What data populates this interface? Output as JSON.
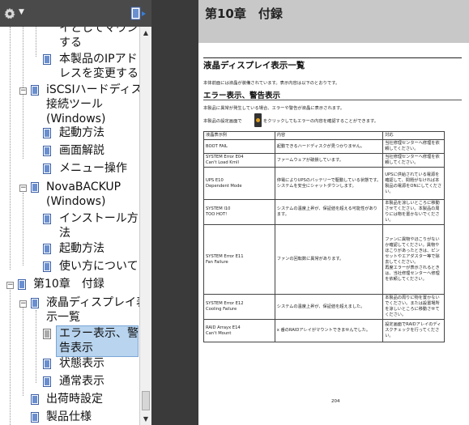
{
  "sidebar": {
    "toolbar": {
      "options_icon": "gear-icon",
      "bookmark_options_icon": "bookmark-options-icon"
    },
    "items": [
      {
        "label_lines": [
          "イとしてマウント",
          "する"
        ],
        "icon": "bookmark-icon"
      },
      {
        "label_lines": [
          "本製品のIPアド",
          "レスを変更する"
        ],
        "icon": "bookmark-icon"
      },
      {
        "label_lines": [
          "iSCSIハードディスク",
          "接続ツール",
          "(Windows)"
        ],
        "icon": "bookmark-icon",
        "expanded": true
      },
      {
        "label_lines": [
          "起動方法"
        ],
        "icon": "bookmark-icon"
      },
      {
        "label_lines": [
          "画面解説"
        ],
        "icon": "bookmark-icon"
      },
      {
        "label_lines": [
          "メニュー操作"
        ],
        "icon": "bookmark-icon"
      },
      {
        "label_lines": [
          "NovaBACKUP",
          "(Windows)"
        ],
        "icon": "bookmark-icon",
        "expanded": true
      },
      {
        "label_lines": [
          "インストール方",
          "法"
        ],
        "icon": "bookmark-icon"
      },
      {
        "label_lines": [
          "起動方法"
        ],
        "icon": "bookmark-icon"
      },
      {
        "label_lines": [
          "使い方について"
        ],
        "icon": "bookmark-icon"
      },
      {
        "label_lines": [
          "第10章　付録"
        ],
        "icon": "bookmark-icon",
        "expanded": true
      },
      {
        "label_lines": [
          "液晶ディスプレイ表",
          "示一覧"
        ],
        "icon": "bookmark-icon",
        "expanded": true
      },
      {
        "label_lines": [
          "エラー表示、警",
          "告表示"
        ],
        "icon": "bookmark-icon",
        "selected": true
      },
      {
        "label_lines": [
          "状態表示"
        ],
        "icon": "bookmark-icon"
      },
      {
        "label_lines": [
          "通常表示"
        ],
        "icon": "bookmark-icon"
      },
      {
        "label_lines": [
          "出荷時設定"
        ],
        "icon": "bookmark-icon"
      },
      {
        "label_lines": [
          "製品仕様"
        ],
        "icon": "bookmark-icon"
      }
    ]
  },
  "page": {
    "chapter_title": "第10章　付録",
    "section_title": "液晶ディスプレイ表示一覧",
    "intro": "本体前面には液晶が装備されています。表示内容は以下のとおりです。",
    "subsection_title": "エラー表示、警告表示",
    "desc1": "本製品に異常が発生している場合、エラーや警告が液晶に表示されます。",
    "desc2a": "本製品の設定画面で",
    "desc2b": "をクリックしてもエラーの内容を確認することができます。",
    "table": {
      "headers": [
        "液晶表示例",
        "内容",
        "対応"
      ],
      "rows": [
        [
          "BOOT FAIL",
          "起動できるハードディスクが見つかりません。",
          "当社修理センターへ修理を依頼してください。"
        ],
        [
          "SYSTEM Error E04\nCan't Load Krnll",
          "ファームウェアが破損しています。",
          "当社修理センターへ修理を依頼してください。"
        ],
        [
          "UPS E10\nDependent Mode",
          "停電によりUPSのバッテリーで駆動している状態です。システムを安全にシャットダウンします。",
          "UPSに供給されている電源を確認して、問題がなければ本製品の電源をONにしてください。"
        ],
        [
          "SYSTEM I10\nTOO HOT!",
          "システムの温度上昇が、保証値を超える可能性があります。",
          "本製品を涼しいところに移動させてください。本製品の周りには物を置かないでください。"
        ],
        [
          "SYSTEM Error E11\nFan Failure",
          "ファンの回転数に異常があります。",
          "ファンに異物やほこりがないか確認してください。異物やほこりがあったときは、ピンセットやエアダスター等で除去してください。\n再度エラーが表示されるときは、当社修理センターへ修理を依頼してください。"
        ],
        [
          "SYSTEM Error E12\nCooling Failure",
          "システムの温度上昇が、保証値を超えました。",
          "本製品の周りに物を置かないでください。または設置場所を涼しいところに移動させてください。"
        ],
        [
          "RAID Arrayx E14\nCan't Mount",
          "x 番のRAIDアレイがマウントできませんでした。",
          "設定画面でRAIDアレイのディスクチェックを行ってください。"
        ]
      ]
    },
    "page_number": "204"
  }
}
